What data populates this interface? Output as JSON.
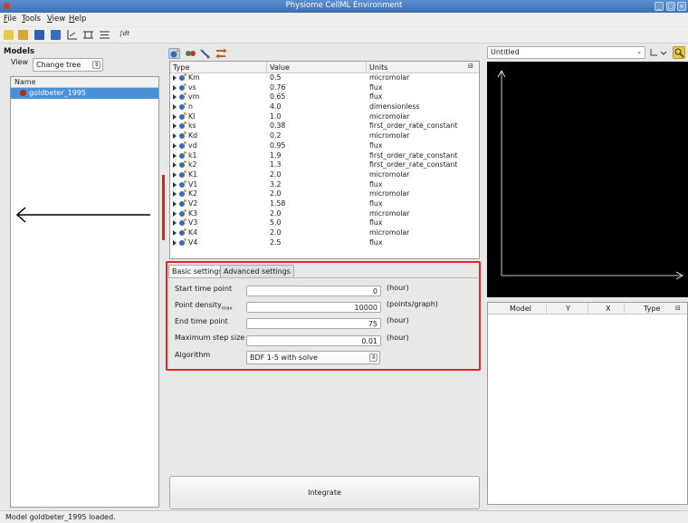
{
  "window": {
    "title": "Physiome CellML Environment"
  },
  "menu": [
    "File",
    "Tools",
    "View",
    "Help"
  ],
  "toolbar": {
    "integral_symbol": "∫dt"
  },
  "models_panel": {
    "title": "Models",
    "view_label": "View",
    "view_value": "Change tree",
    "tree_header": "Name",
    "tree_items": [
      "goldbeter_1995"
    ]
  },
  "variables_table": {
    "columns": [
      "Type",
      "Value",
      "Units"
    ],
    "rows": [
      {
        "name": "Km",
        "value": "0.5",
        "units": "micromolar"
      },
      {
        "name": "vs",
        "value": "0.76",
        "units": "flux"
      },
      {
        "name": "vm",
        "value": "0.65",
        "units": "flux"
      },
      {
        "name": "n",
        "value": "4.0",
        "units": "dimensionless"
      },
      {
        "name": "KI",
        "value": "1.0",
        "units": "micromolar"
      },
      {
        "name": "ks",
        "value": "0.38",
        "units": "first_order_rate_constant"
      },
      {
        "name": "Kd",
        "value": "0.2",
        "units": "micromolar"
      },
      {
        "name": "vd",
        "value": "0.95",
        "units": "flux"
      },
      {
        "name": "k1",
        "value": "1.9",
        "units": "first_order_rate_constant"
      },
      {
        "name": "k2",
        "value": "1.3",
        "units": "first_order_rate_constant"
      },
      {
        "name": "K1",
        "value": "2.0",
        "units": "micromolar"
      },
      {
        "name": "V1",
        "value": "3.2",
        "units": "flux"
      },
      {
        "name": "K2",
        "value": "2.0",
        "units": "micromolar"
      },
      {
        "name": "V2",
        "value": "1.58",
        "units": "flux"
      },
      {
        "name": "K3",
        "value": "2.0",
        "units": "micromolar"
      },
      {
        "name": "V3",
        "value": "5.0",
        "units": "flux"
      },
      {
        "name": "K4",
        "value": "2.0",
        "units": "micromolar"
      },
      {
        "name": "V4",
        "value": "2.5",
        "units": "flux"
      }
    ]
  },
  "settings": {
    "tabs": [
      "Basic settings",
      "Advanced settings"
    ],
    "start_time_label": "Start time point",
    "start_time_value": "0",
    "start_time_unit": "(hour)",
    "point_density_label": "Point density",
    "point_density_sub": "max",
    "point_density_value": "10000",
    "point_density_unit": "(points/graph)",
    "end_time_label": "End time point",
    "end_time_value": "75",
    "end_time_unit": "(hour)",
    "max_step_label": "Maximum step size",
    "max_step_value": "0.01",
    "max_step_unit": "(hour)",
    "algorithm_label": "Algorithm",
    "algorithm_value": "BDF 1-5 with solve"
  },
  "integrate_label": "Integrate",
  "graph_panel": {
    "selected": "Untitled",
    "results_columns": [
      "Model",
      "Y",
      "X",
      "Type"
    ]
  },
  "status": "Model goldbeter_1995 loaded.",
  "colors": {
    "selection": "#4a90d9",
    "annotation_red": "#e0282a",
    "titlebar": "#3d6fb5"
  }
}
